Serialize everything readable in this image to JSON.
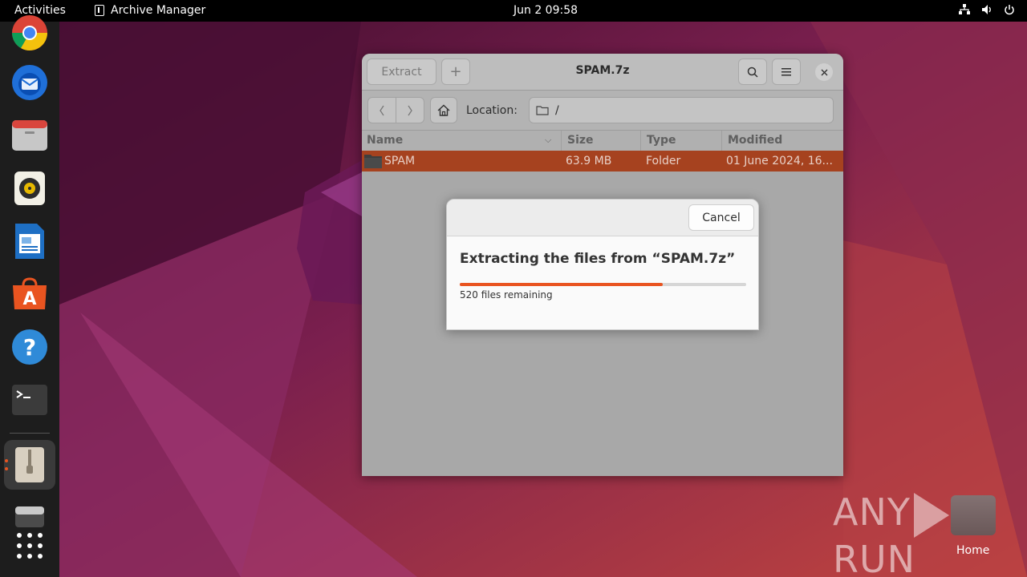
{
  "topbar": {
    "activities": "Activities",
    "app_name": "Archive Manager",
    "clock": "Jun 2  09:58",
    "tray_icons": [
      "network-icon",
      "volume-icon",
      "power-icon"
    ]
  },
  "dock": {
    "items": [
      "chrome-icon",
      "thunderbird-icon",
      "files-icon",
      "rhythmbox-icon",
      "writer-icon",
      "app-center-icon",
      "help-icon",
      "terminal-icon",
      "archive-manager-icon",
      "drive-icon",
      "show-apps-icon"
    ]
  },
  "window": {
    "title": "SPAM.7z",
    "extract_label": "Extract",
    "add_label": "+",
    "location_label": "Location:",
    "location_path": "/",
    "columns": [
      "Name",
      "Size",
      "Type",
      "Modified"
    ],
    "rows": [
      {
        "name": "SPAM",
        "size": "63.9 MB",
        "type": "Folder",
        "modified": "01 June 2024, 16..."
      }
    ]
  },
  "dialog": {
    "cancel_label": "Cancel",
    "title": "Extracting the files from “SPAM.7z”",
    "progress": 0.71,
    "status": "520 files remaining"
  },
  "desktop": {
    "home_label": "Home",
    "watermark": "ANY RUN"
  },
  "colors": {
    "accent": "#e95420",
    "selection": "#a6421f"
  }
}
